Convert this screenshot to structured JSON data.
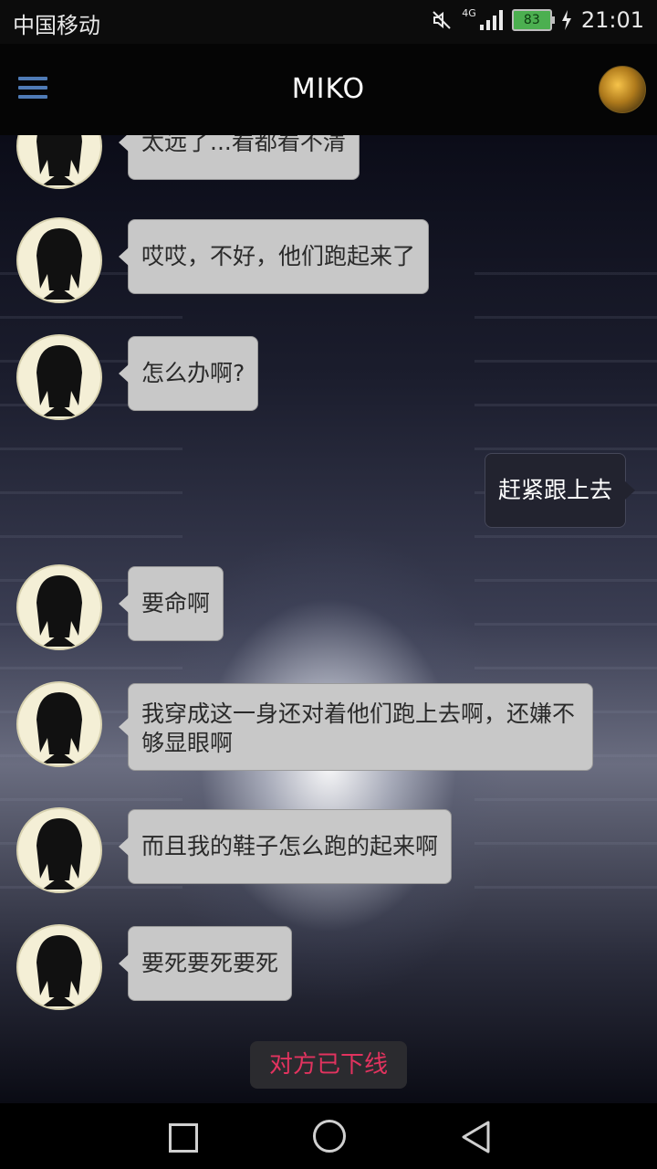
{
  "status_bar": {
    "carrier": "中国移动",
    "network": "4G",
    "battery": "83",
    "time": "21:01"
  },
  "app_bar": {
    "title": "MIKO"
  },
  "messages": [
    {
      "from": "other",
      "text": "太远了...看都看不清"
    },
    {
      "from": "other",
      "text": "哎哎，不好，他们跑起来了"
    },
    {
      "from": "other",
      "text": "怎么办啊?"
    },
    {
      "from": "me",
      "text": "赶紧跟上去"
    },
    {
      "from": "other",
      "text": "要命啊"
    },
    {
      "from": "other",
      "text": "我穿成这一身还对着他们跑上去啊，还嫌不够显眼啊"
    },
    {
      "from": "other",
      "text": "而且我的鞋子怎么跑的起来啊"
    },
    {
      "from": "other",
      "text": "要死要死要死"
    }
  ],
  "status_notice": "对方已下线",
  "colors": {
    "offline_text": "#e2335f",
    "menu_icon": "#4f7bb6"
  }
}
